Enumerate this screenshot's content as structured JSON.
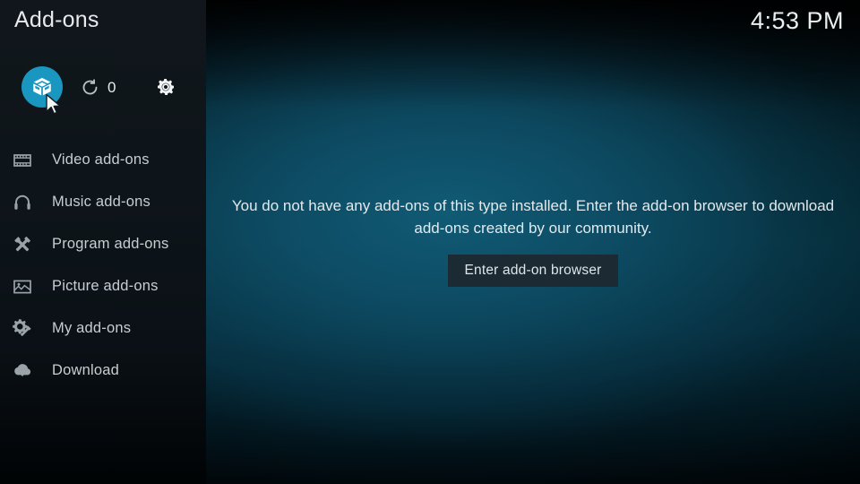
{
  "window": {
    "title": "Add-ons",
    "clock": "4:53 PM"
  },
  "toolbar": {
    "addon_browser": {
      "icon": "open-box-icon",
      "label": "Add-on browser",
      "selected": true
    },
    "updates": {
      "icon": "refresh-icon",
      "count": "0",
      "label": "Available updates"
    },
    "settings": {
      "icon": "gear-icon",
      "label": "Settings"
    }
  },
  "sidebar": {
    "items": [
      {
        "label": "Video add-ons",
        "icon": "film-strip-icon"
      },
      {
        "label": "Music add-ons",
        "icon": "headphones-icon"
      },
      {
        "label": "Program add-ons",
        "icon": "crossed-tools-icon"
      },
      {
        "label": "Picture add-ons",
        "icon": "picture-icon"
      },
      {
        "label": "My add-ons",
        "icon": "gear-tool-icon"
      },
      {
        "label": "Download",
        "icon": "cloud-download-icon"
      }
    ]
  },
  "main": {
    "empty_message": "You do not have any add-ons of this type installed. Enter the add-on browser to download add-ons created by our community.",
    "browse_button": "Enter add-on browser"
  },
  "colors": {
    "accent": "#1a97c0",
    "sidebar_bg": "#10161b",
    "content_bg": "#073a4a",
    "button_bg": "#1c2a33",
    "text_primary": "#e7ebee",
    "text_secondary": "#c7ced2"
  }
}
